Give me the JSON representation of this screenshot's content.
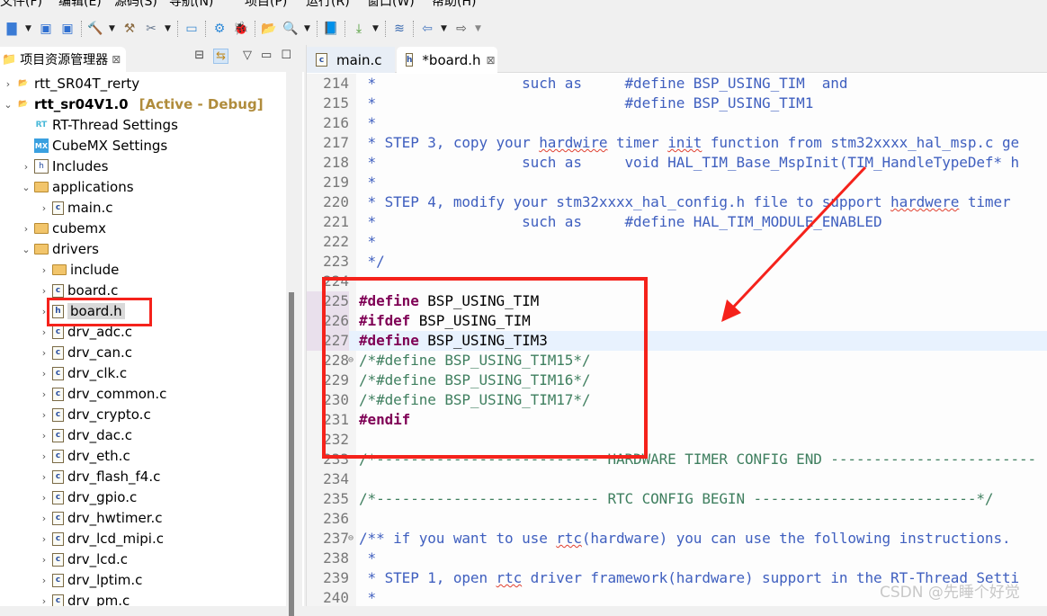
{
  "menu": [
    "文件(F)",
    "编辑(E)",
    "源码(S)",
    "导航(N)",
    "项目(P)",
    "运行(R)",
    "窗口(W)",
    "帮助(H)"
  ],
  "left_panel": {
    "title": "项目资源管理器",
    "close": "⊠"
  },
  "tree": [
    {
      "label": "rtt_SR04T_rerty",
      "level": 0,
      "chev": "›",
      "icon": "project"
    },
    {
      "label": "rtt_sr04V1.0",
      "level": 0,
      "chev": "⌄",
      "icon": "project",
      "bold": true,
      "suffix": "[Active - Debug]"
    },
    {
      "label": "RT-Thread Settings",
      "level": 1,
      "chev": "",
      "icon": "rt"
    },
    {
      "label": "CubeMX Settings",
      "level": 1,
      "chev": "",
      "icon": "mx"
    },
    {
      "label": "Includes",
      "level": 1,
      "chev": "›",
      "icon": "includes"
    },
    {
      "label": "applications",
      "level": 1,
      "chev": "⌄",
      "icon": "folder"
    },
    {
      "label": "main.c",
      "level": 2,
      "chev": "›",
      "icon": "c"
    },
    {
      "label": "cubemx",
      "level": 1,
      "chev": "›",
      "icon": "folder"
    },
    {
      "label": "drivers",
      "level": 1,
      "chev": "⌄",
      "icon": "folder"
    },
    {
      "label": "include",
      "level": 2,
      "chev": "›",
      "icon": "folder"
    },
    {
      "label": "board.c",
      "level": 2,
      "chev": "›",
      "icon": "c"
    },
    {
      "label": "board.h",
      "level": 2,
      "chev": "›",
      "icon": "h",
      "selected": true
    },
    {
      "label": "drv_adc.c",
      "level": 2,
      "chev": "›",
      "icon": "c"
    },
    {
      "label": "drv_can.c",
      "level": 2,
      "chev": "›",
      "icon": "c"
    },
    {
      "label": "drv_clk.c",
      "level": 2,
      "chev": "›",
      "icon": "c"
    },
    {
      "label": "drv_common.c",
      "level": 2,
      "chev": "›",
      "icon": "c"
    },
    {
      "label": "drv_crypto.c",
      "level": 2,
      "chev": "›",
      "icon": "c"
    },
    {
      "label": "drv_dac.c",
      "level": 2,
      "chev": "›",
      "icon": "c"
    },
    {
      "label": "drv_eth.c",
      "level": 2,
      "chev": "›",
      "icon": "c"
    },
    {
      "label": "drv_flash_f4.c",
      "level": 2,
      "chev": "›",
      "icon": "c"
    },
    {
      "label": "drv_gpio.c",
      "level": 2,
      "chev": "›",
      "icon": "c"
    },
    {
      "label": "drv_hwtimer.c",
      "level": 2,
      "chev": "›",
      "icon": "c"
    },
    {
      "label": "drv_lcd_mipi.c",
      "level": 2,
      "chev": "›",
      "icon": "c"
    },
    {
      "label": "drv_lcd.c",
      "level": 2,
      "chev": "›",
      "icon": "c"
    },
    {
      "label": "drv_lptim.c",
      "level": 2,
      "chev": "›",
      "icon": "c"
    },
    {
      "label": "drv_pm.c",
      "level": 2,
      "chev": "›",
      "icon": "c"
    }
  ],
  "editor_tabs": [
    {
      "label": "main.c",
      "icon": "c",
      "active": false
    },
    {
      "label": "*board.h",
      "icon": "h",
      "active": true,
      "close": "⊠"
    }
  ],
  "current_line": 227,
  "code": [
    {
      "n": "214",
      "s": [
        [
          " *                 such as     #define BSP_USING_TIM  and",
          "c"
        ]
      ]
    },
    {
      "n": "215",
      "s": [
        [
          " *                             #define BSP_USING_TIM1",
          "c"
        ]
      ]
    },
    {
      "n": "216",
      "s": [
        [
          " *",
          "c"
        ]
      ]
    },
    {
      "n": "217",
      "s": [
        [
          " * STEP 3, copy your ",
          "c"
        ],
        [
          "hardwire",
          "s"
        ],
        [
          " timer ",
          "c"
        ],
        [
          "init",
          "s"
        ],
        [
          " function from stm32xxxx_hal_msp.c ge",
          "c"
        ]
      ]
    },
    {
      "n": "218",
      "s": [
        [
          " *                 such as     void HAL_TIM_Base_MspInit(TIM_HandleTypeDef* h",
          "c"
        ]
      ]
    },
    {
      "n": "219",
      "s": [
        [
          " *",
          "c"
        ]
      ]
    },
    {
      "n": "220",
      "s": [
        [
          " * STEP 4, modify your stm32xxxx_hal_config.h file to support ",
          "c"
        ],
        [
          "hardwere",
          "s"
        ],
        [
          " timer",
          "c"
        ]
      ]
    },
    {
      "n": "221",
      "s": [
        [
          " *                 such as     #define HAL_TIM_MODULE_ENABLED",
          "c"
        ]
      ]
    },
    {
      "n": "222",
      "s": [
        [
          " *",
          "c"
        ]
      ]
    },
    {
      "n": "223",
      "s": [
        [
          " */",
          "c"
        ]
      ]
    },
    {
      "n": "224",
      "s": []
    },
    {
      "n": "225",
      "s": [
        [
          "#define",
          "k"
        ],
        [
          " BSP_USING_TIM",
          "n"
        ]
      ]
    },
    {
      "n": "226",
      "s": [
        [
          "#ifdef",
          "k"
        ],
        [
          " BSP_USING_TIM",
          "n"
        ]
      ]
    },
    {
      "n": "227",
      "s": [
        [
          "#define",
          "k"
        ],
        [
          " BSP_USING_TIM3",
          "n"
        ]
      ]
    },
    {
      "n": "228",
      "fold": true,
      "s": [
        [
          "/*#define BSP_USING_TIM15*/",
          "g"
        ]
      ]
    },
    {
      "n": "229",
      "s": [
        [
          "/*#define BSP_USING_TIM16*/",
          "g"
        ]
      ]
    },
    {
      "n": "230",
      "s": [
        [
          "/*#define BSP_USING_TIM17*/",
          "g"
        ]
      ]
    },
    {
      "n": "231",
      "s": [
        [
          "#endif",
          "k"
        ]
      ]
    },
    {
      "n": "232",
      "s": []
    },
    {
      "n": "233",
      "s": [
        [
          "/*-------------------------- HARDWARE TIMER CONFIG END ------------------------",
          "g"
        ]
      ]
    },
    {
      "n": "234",
      "s": []
    },
    {
      "n": "235",
      "s": [
        [
          "/*-------------------------- RTC CONFIG BEGIN --------------------------*/",
          "g"
        ]
      ]
    },
    {
      "n": "236",
      "s": []
    },
    {
      "n": "237",
      "fold": true,
      "s": [
        [
          "/** if you want to use ",
          "c"
        ],
        [
          "rtc",
          "s"
        ],
        [
          "(hardware) you can use the following instructions.",
          "c"
        ]
      ]
    },
    {
      "n": "238",
      "s": [
        [
          " *",
          "c"
        ]
      ]
    },
    {
      "n": "239",
      "s": [
        [
          " * STEP 1, open ",
          "c"
        ],
        [
          "rtc",
          "s"
        ],
        [
          " driver framework(hardware) support in the RT-Thread Setti",
          "c"
        ]
      ]
    },
    {
      "n": "240",
      "s": [
        [
          " *",
          "c"
        ]
      ]
    }
  ],
  "watermark": "CSDN @先睡个好觉",
  "colors": {
    "annotation": "#f5221b",
    "comment": "#3f5fbf",
    "keyword": "#7f0055",
    "disabled_code": "#3f7f5f"
  }
}
